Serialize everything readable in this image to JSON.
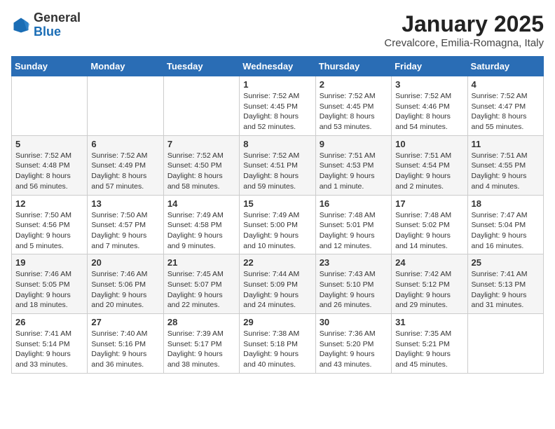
{
  "header": {
    "logo_general": "General",
    "logo_blue": "Blue",
    "month": "January 2025",
    "location": "Crevalcore, Emilia-Romagna, Italy"
  },
  "days_of_week": [
    "Sunday",
    "Monday",
    "Tuesday",
    "Wednesday",
    "Thursday",
    "Friday",
    "Saturday"
  ],
  "weeks": [
    [
      {
        "day": "",
        "info": ""
      },
      {
        "day": "",
        "info": ""
      },
      {
        "day": "",
        "info": ""
      },
      {
        "day": "1",
        "info": "Sunrise: 7:52 AM\nSunset: 4:45 PM\nDaylight: 8 hours and 52 minutes."
      },
      {
        "day": "2",
        "info": "Sunrise: 7:52 AM\nSunset: 4:45 PM\nDaylight: 8 hours and 53 minutes."
      },
      {
        "day": "3",
        "info": "Sunrise: 7:52 AM\nSunset: 4:46 PM\nDaylight: 8 hours and 54 minutes."
      },
      {
        "day": "4",
        "info": "Sunrise: 7:52 AM\nSunset: 4:47 PM\nDaylight: 8 hours and 55 minutes."
      }
    ],
    [
      {
        "day": "5",
        "info": "Sunrise: 7:52 AM\nSunset: 4:48 PM\nDaylight: 8 hours and 56 minutes."
      },
      {
        "day": "6",
        "info": "Sunrise: 7:52 AM\nSunset: 4:49 PM\nDaylight: 8 hours and 57 minutes."
      },
      {
        "day": "7",
        "info": "Sunrise: 7:52 AM\nSunset: 4:50 PM\nDaylight: 8 hours and 58 minutes."
      },
      {
        "day": "8",
        "info": "Sunrise: 7:52 AM\nSunset: 4:51 PM\nDaylight: 8 hours and 59 minutes."
      },
      {
        "day": "9",
        "info": "Sunrise: 7:51 AM\nSunset: 4:53 PM\nDaylight: 9 hours and 1 minute."
      },
      {
        "day": "10",
        "info": "Sunrise: 7:51 AM\nSunset: 4:54 PM\nDaylight: 9 hours and 2 minutes."
      },
      {
        "day": "11",
        "info": "Sunrise: 7:51 AM\nSunset: 4:55 PM\nDaylight: 9 hours and 4 minutes."
      }
    ],
    [
      {
        "day": "12",
        "info": "Sunrise: 7:50 AM\nSunset: 4:56 PM\nDaylight: 9 hours and 5 minutes."
      },
      {
        "day": "13",
        "info": "Sunrise: 7:50 AM\nSunset: 4:57 PM\nDaylight: 9 hours and 7 minutes."
      },
      {
        "day": "14",
        "info": "Sunrise: 7:49 AM\nSunset: 4:58 PM\nDaylight: 9 hours and 9 minutes."
      },
      {
        "day": "15",
        "info": "Sunrise: 7:49 AM\nSunset: 5:00 PM\nDaylight: 9 hours and 10 minutes."
      },
      {
        "day": "16",
        "info": "Sunrise: 7:48 AM\nSunset: 5:01 PM\nDaylight: 9 hours and 12 minutes."
      },
      {
        "day": "17",
        "info": "Sunrise: 7:48 AM\nSunset: 5:02 PM\nDaylight: 9 hours and 14 minutes."
      },
      {
        "day": "18",
        "info": "Sunrise: 7:47 AM\nSunset: 5:04 PM\nDaylight: 9 hours and 16 minutes."
      }
    ],
    [
      {
        "day": "19",
        "info": "Sunrise: 7:46 AM\nSunset: 5:05 PM\nDaylight: 9 hours and 18 minutes."
      },
      {
        "day": "20",
        "info": "Sunrise: 7:46 AM\nSunset: 5:06 PM\nDaylight: 9 hours and 20 minutes."
      },
      {
        "day": "21",
        "info": "Sunrise: 7:45 AM\nSunset: 5:07 PM\nDaylight: 9 hours and 22 minutes."
      },
      {
        "day": "22",
        "info": "Sunrise: 7:44 AM\nSunset: 5:09 PM\nDaylight: 9 hours and 24 minutes."
      },
      {
        "day": "23",
        "info": "Sunrise: 7:43 AM\nSunset: 5:10 PM\nDaylight: 9 hours and 26 minutes."
      },
      {
        "day": "24",
        "info": "Sunrise: 7:42 AM\nSunset: 5:12 PM\nDaylight: 9 hours and 29 minutes."
      },
      {
        "day": "25",
        "info": "Sunrise: 7:41 AM\nSunset: 5:13 PM\nDaylight: 9 hours and 31 minutes."
      }
    ],
    [
      {
        "day": "26",
        "info": "Sunrise: 7:41 AM\nSunset: 5:14 PM\nDaylight: 9 hours and 33 minutes."
      },
      {
        "day": "27",
        "info": "Sunrise: 7:40 AM\nSunset: 5:16 PM\nDaylight: 9 hours and 36 minutes."
      },
      {
        "day": "28",
        "info": "Sunrise: 7:39 AM\nSunset: 5:17 PM\nDaylight: 9 hours and 38 minutes."
      },
      {
        "day": "29",
        "info": "Sunrise: 7:38 AM\nSunset: 5:18 PM\nDaylight: 9 hours and 40 minutes."
      },
      {
        "day": "30",
        "info": "Sunrise: 7:36 AM\nSunset: 5:20 PM\nDaylight: 9 hours and 43 minutes."
      },
      {
        "day": "31",
        "info": "Sunrise: 7:35 AM\nSunset: 5:21 PM\nDaylight: 9 hours and 45 minutes."
      },
      {
        "day": "",
        "info": ""
      }
    ]
  ]
}
